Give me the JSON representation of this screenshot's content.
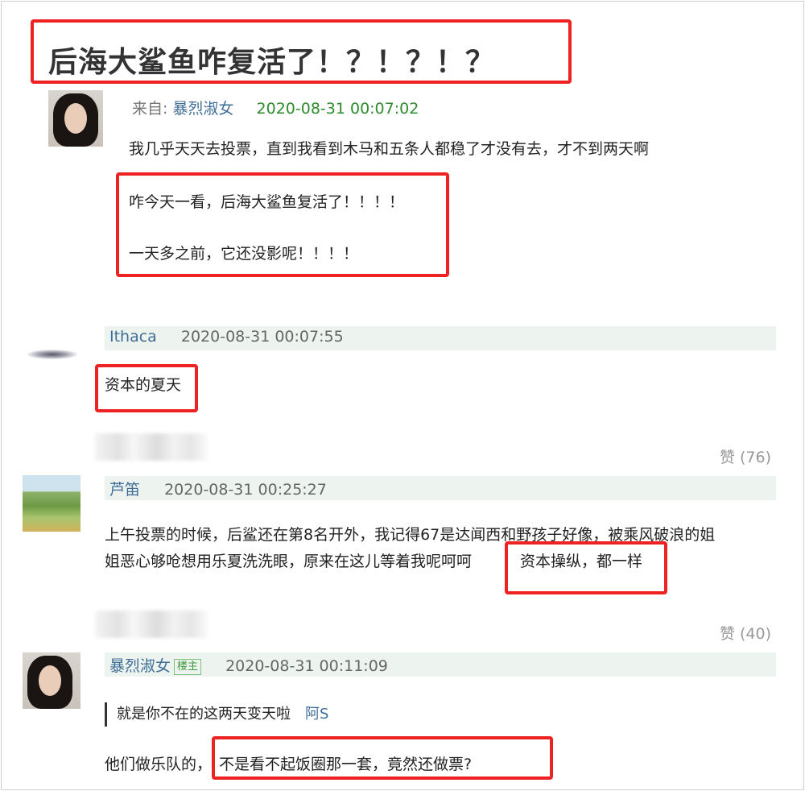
{
  "title": "后海大鲨鱼咋复活了！？！？！？",
  "post": {
    "from_label": "来自:",
    "author": "暴烈淑女",
    "time": "2020-08-31 00:07:02",
    "line1": "我几乎天天去投票，直到我看到木马和五条人都稳了才没有去，才不到两天啊",
    "line2": "咋今天一看，后海大鲨鱼复活了！！！！",
    "line3": "一天多之前，它还没影呢！！！！"
  },
  "comments": [
    {
      "author": "Ithaca",
      "time": "2020-08-31 00:07:55",
      "text": "资本的夏天",
      "likes": "赞 (76)"
    },
    {
      "author": "芦笛",
      "time": "2020-08-31 00:25:27",
      "line1": "上午投票的时候，后鲨还在第8名开外，我记得67是达闻西和野孩子好像，被乘风破浪的姐",
      "line2": "姐恶心够呛想用乐夏洗洗眼，原来在这儿等着我呢呵呵",
      "line2_highlight": "资本操纵，都一样",
      "likes": "赞 (40)"
    },
    {
      "author": "暴烈淑女",
      "badge": "楼主",
      "time": "2020-08-31 00:11:09",
      "quote": "就是你不在的这两天变天啦",
      "quote_at": "阿S",
      "text_prefix": "他们做乐队的，",
      "text_highlight": "不是看不起饭圈那一套，竟然还做票?"
    }
  ],
  "colors": {
    "highlight_border": "#ee2222",
    "username": "#3f6e99",
    "timestamp_green": "#2e8b2e",
    "header_bar": "#edf3ee"
  }
}
